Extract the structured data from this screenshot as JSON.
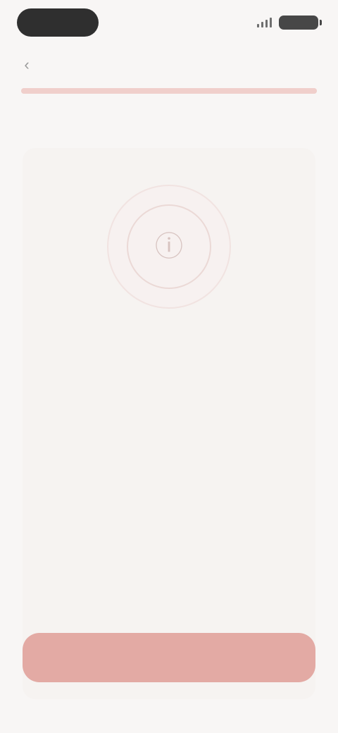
{
  "status_bar": {},
  "nav": {
    "back_glyph": "‹"
  },
  "progress": {
    "value": 1.0
  },
  "steps": {
    "current": "",
    "next": ""
  },
  "card": {
    "icon": "info-ring-icon",
    "headline": "",
    "body": "",
    "footnote": ""
  },
  "actions": {
    "primary_label": ""
  },
  "colors": {
    "background": "#f8f6f5",
    "progress_track": "#f3e3e1",
    "progress_fill": "#f0cfcb",
    "button": "#e3aaa4"
  }
}
